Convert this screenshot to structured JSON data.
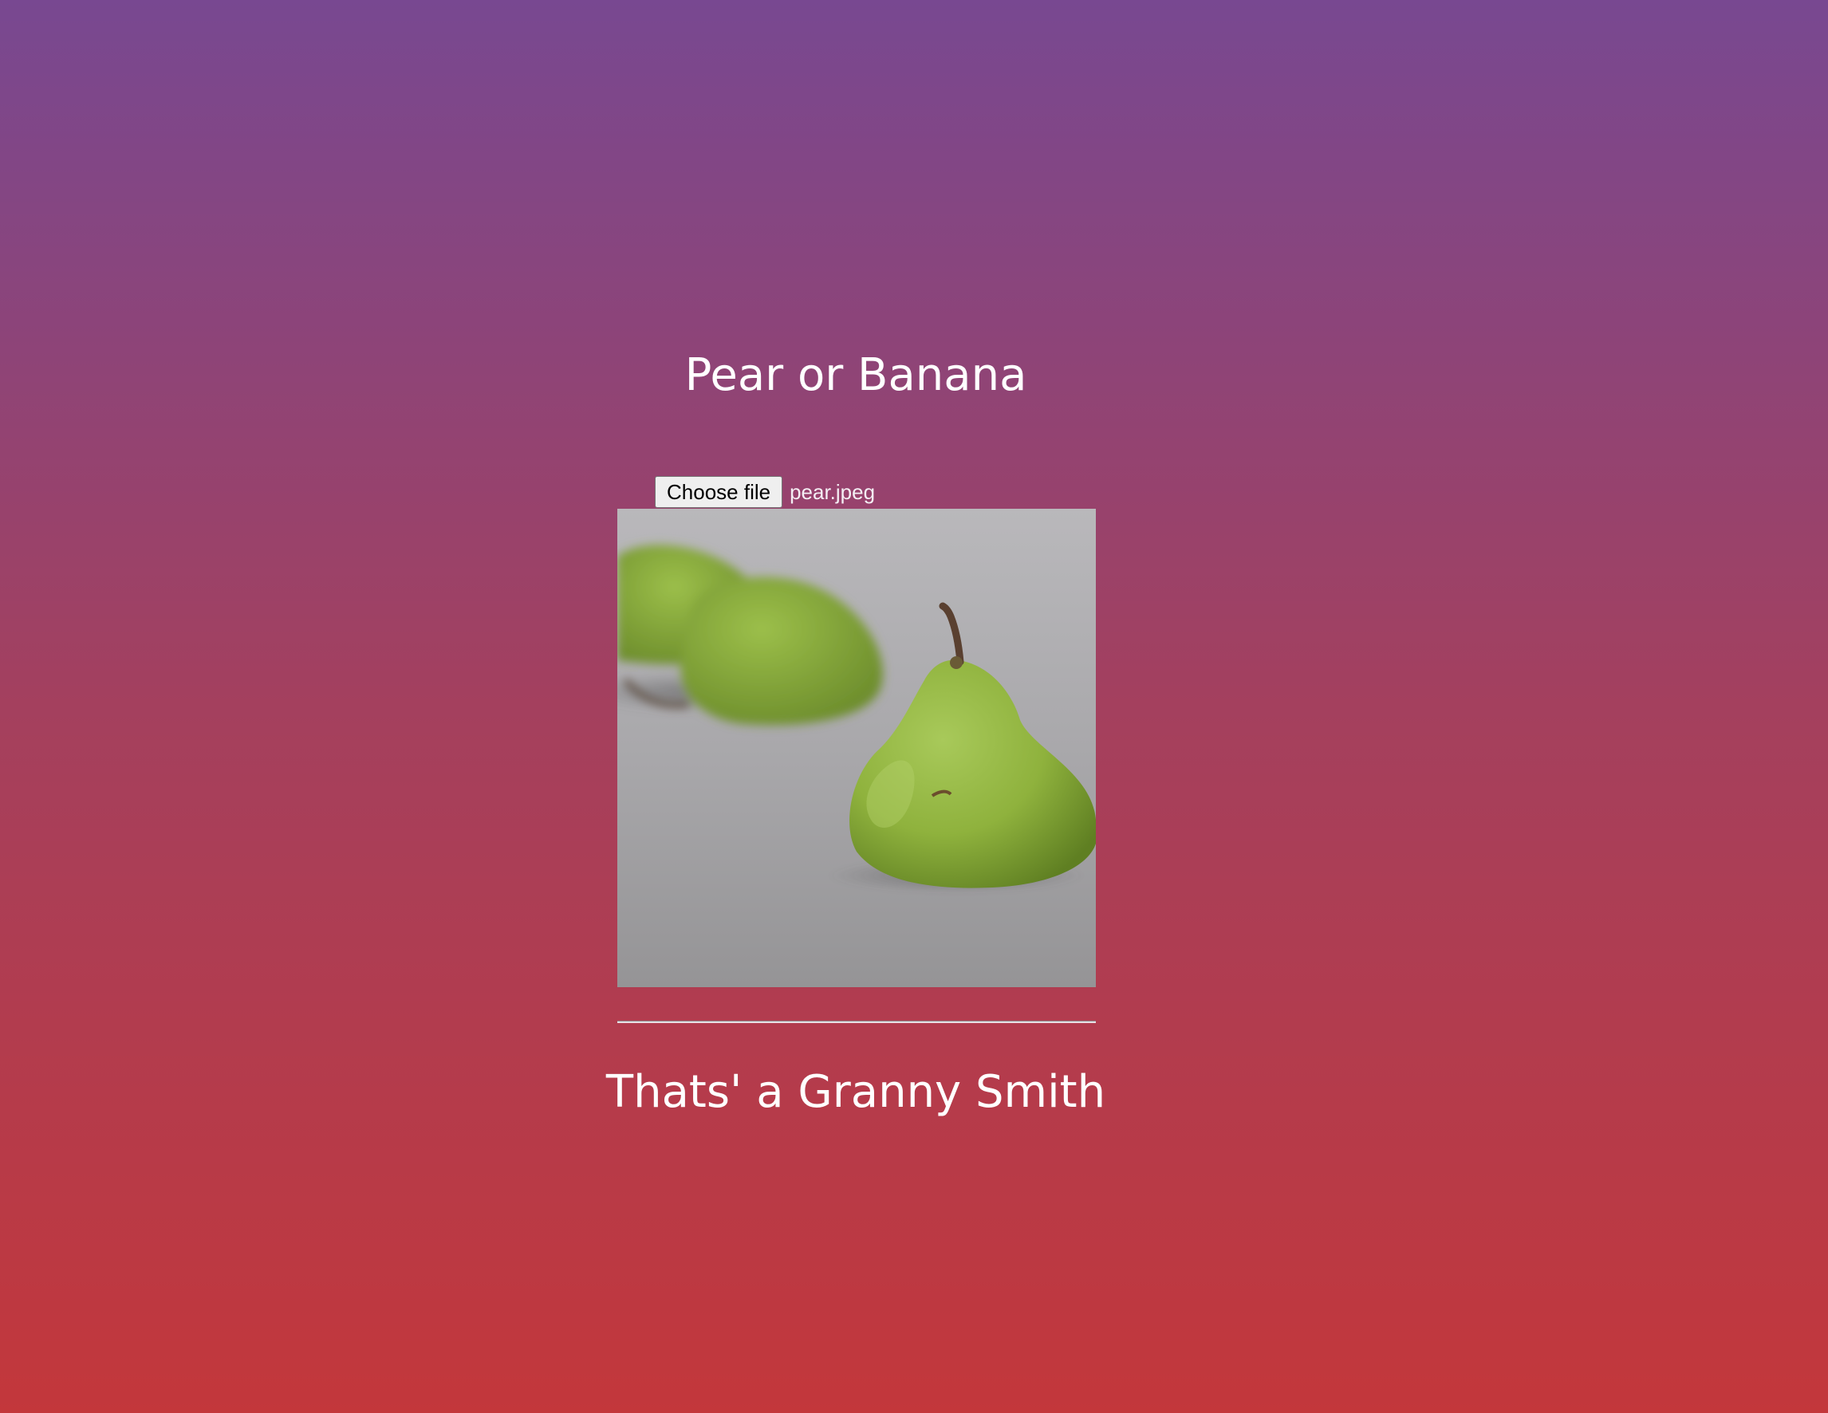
{
  "app": {
    "title": "Pear or Banana"
  },
  "upload": {
    "button_label": "Choose file",
    "file_name": "pear.jpeg"
  },
  "preview": {
    "alt": "pear.jpeg"
  },
  "result": {
    "text": "Thats' a Granny Smith"
  },
  "colors": {
    "background_top": "#784891",
    "background_bottom": "#c3373b",
    "text": "#ffffff",
    "button_background": "#efefef",
    "pear_green": "#8fb23d"
  }
}
